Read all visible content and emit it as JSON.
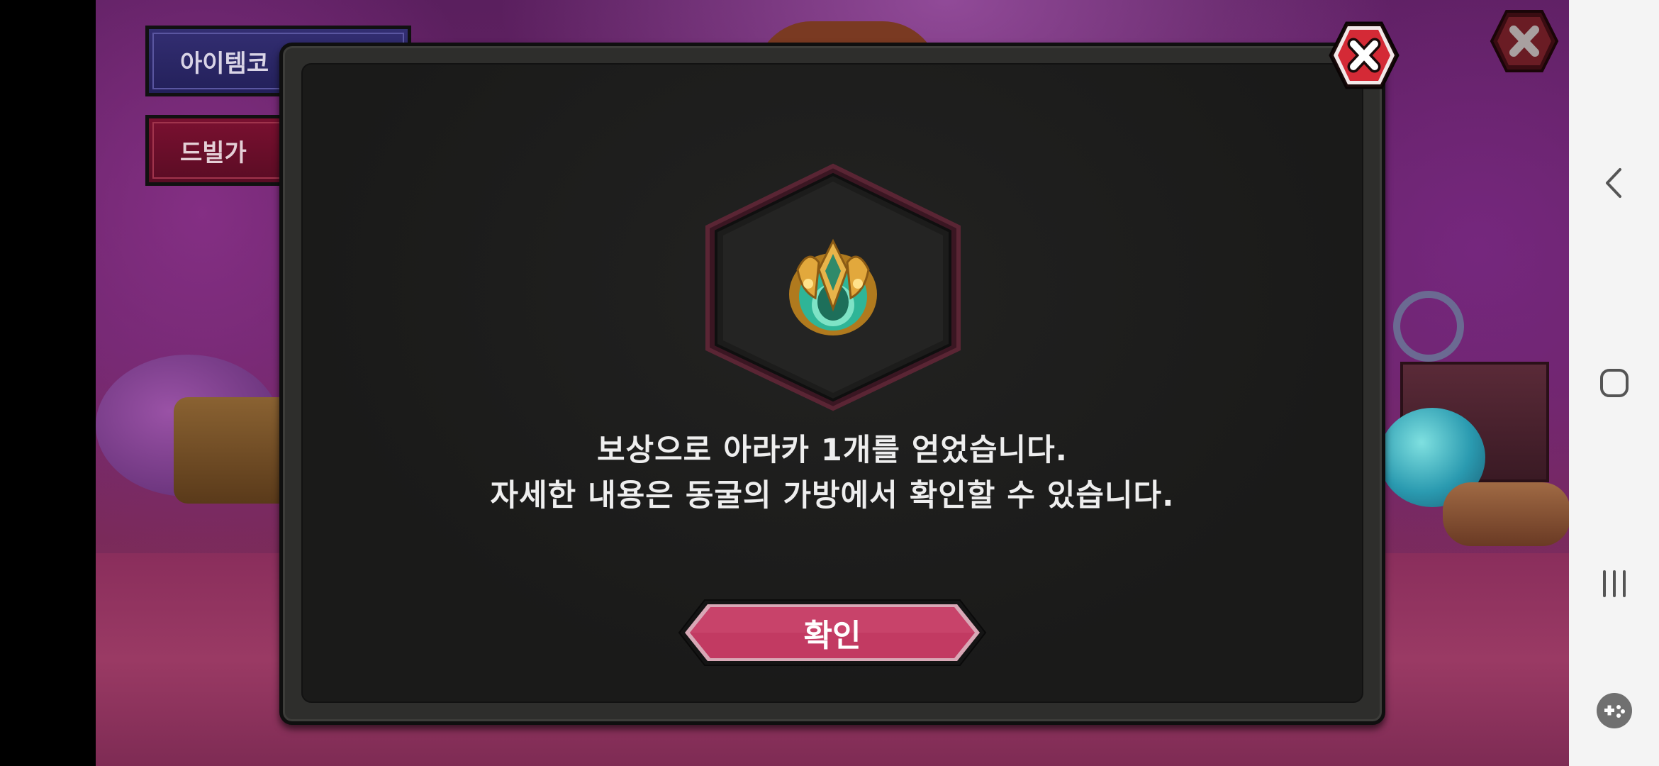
{
  "background": {
    "side_buttons": [
      {
        "label": "아이템코"
      },
      {
        "label": "드빌가"
      }
    ]
  },
  "dialog": {
    "message_line1": "보상으로 아라카 1개를 얻었습니다.",
    "message_line2": "자세한 내용은 동굴의 가방에서 확인할 수 있습니다.",
    "confirm_label": "확인",
    "reward_icon": "araka-emblem-icon",
    "colors": {
      "close_red": "#d42a36",
      "confirm_pink": "#c23a62",
      "hex_border": "#5a2534"
    }
  },
  "nav_bar": {
    "icons": [
      "back-icon",
      "home-icon",
      "recent-apps-icon",
      "game-tools-icon"
    ]
  }
}
